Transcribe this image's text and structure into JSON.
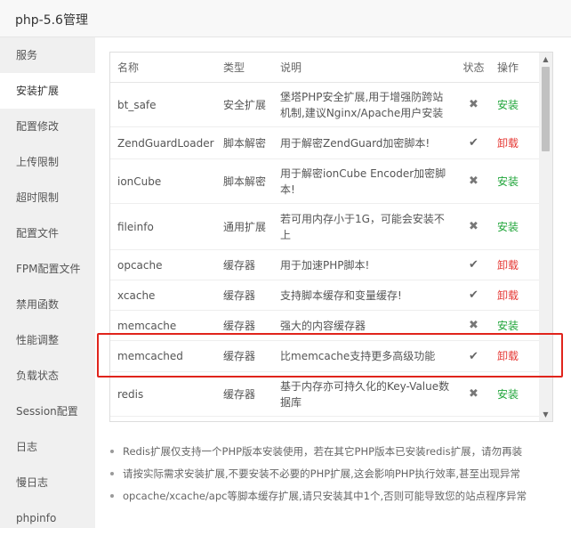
{
  "window": {
    "title": "php-5.6管理"
  },
  "sidebar": {
    "items": [
      {
        "label": "服务"
      },
      {
        "label": "安装扩展"
      },
      {
        "label": "配置修改"
      },
      {
        "label": "上传限制"
      },
      {
        "label": "超时限制"
      },
      {
        "label": "配置文件"
      },
      {
        "label": "FPM配置文件"
      },
      {
        "label": "禁用函数"
      },
      {
        "label": "性能调整"
      },
      {
        "label": "负载状态"
      },
      {
        "label": "Session配置"
      },
      {
        "label": "日志"
      },
      {
        "label": "慢日志"
      },
      {
        "label": "phpinfo"
      }
    ],
    "active": "安装扩展"
  },
  "table": {
    "headers": [
      "名称",
      "类型",
      "说明",
      "状态",
      "操作"
    ],
    "rows": [
      {
        "name": "bt_safe",
        "type": "安全扩展",
        "desc": "堡塔PHP安全扩展,用于增强防跨站机制,建议Nginx/Apache用户安装",
        "status_icon": "✖",
        "action": "安装"
      },
      {
        "name": "ZendGuardLoader",
        "type": "脚本解密",
        "desc": "用于解密ZendGuard加密脚本!",
        "status_icon": "✔",
        "action": "卸载"
      },
      {
        "name": "ionCube",
        "type": "脚本解密",
        "desc": "用于解密ionCube Encoder加密脚本!",
        "status_icon": "✖",
        "action": "安装"
      },
      {
        "name": "fileinfo",
        "type": "通用扩展",
        "desc": "若可用内存小于1G，可能会安装不上",
        "status_icon": "✖",
        "action": "安装"
      },
      {
        "name": "opcache",
        "type": "缓存器",
        "desc": "用于加速PHP脚本!",
        "status_icon": "✔",
        "action": "卸载"
      },
      {
        "name": "xcache",
        "type": "缓存器",
        "desc": "支持脚本缓存和变量缓存!",
        "status_icon": "✔",
        "action": "卸载"
      },
      {
        "name": "memcache",
        "type": "缓存器",
        "desc": "强大的内容缓存器",
        "status_icon": "✖",
        "action": "安装"
      },
      {
        "name": "memcached",
        "type": "缓存器",
        "desc": "比memcache支持更多高级功能",
        "status_icon": "✔",
        "action": "卸载"
      },
      {
        "name": "redis",
        "type": "缓存器",
        "desc": "基于内存亦可持久化的Key-Value数据库",
        "status_icon": "✖",
        "action": "安装"
      }
    ]
  },
  "scrollbar": {
    "up": "▲",
    "down": "▼"
  },
  "notes": [
    "Redis扩展仅支持一个PHP版本安装使用，若在其它PHP版本已安装redis扩展，请勿再装",
    "请按实际需求安装扩展,不要安装不必要的PHP扩展,这会影响PHP执行效率,甚至出现异常",
    "opcache/xcache/apc等脚本缓存扩展,请只安装其中1个,否则可能导致您的站点程序异常"
  ],
  "colors": {
    "install": "#20a53a",
    "uninstall": "#e53935",
    "highlight": "#e0241c"
  }
}
